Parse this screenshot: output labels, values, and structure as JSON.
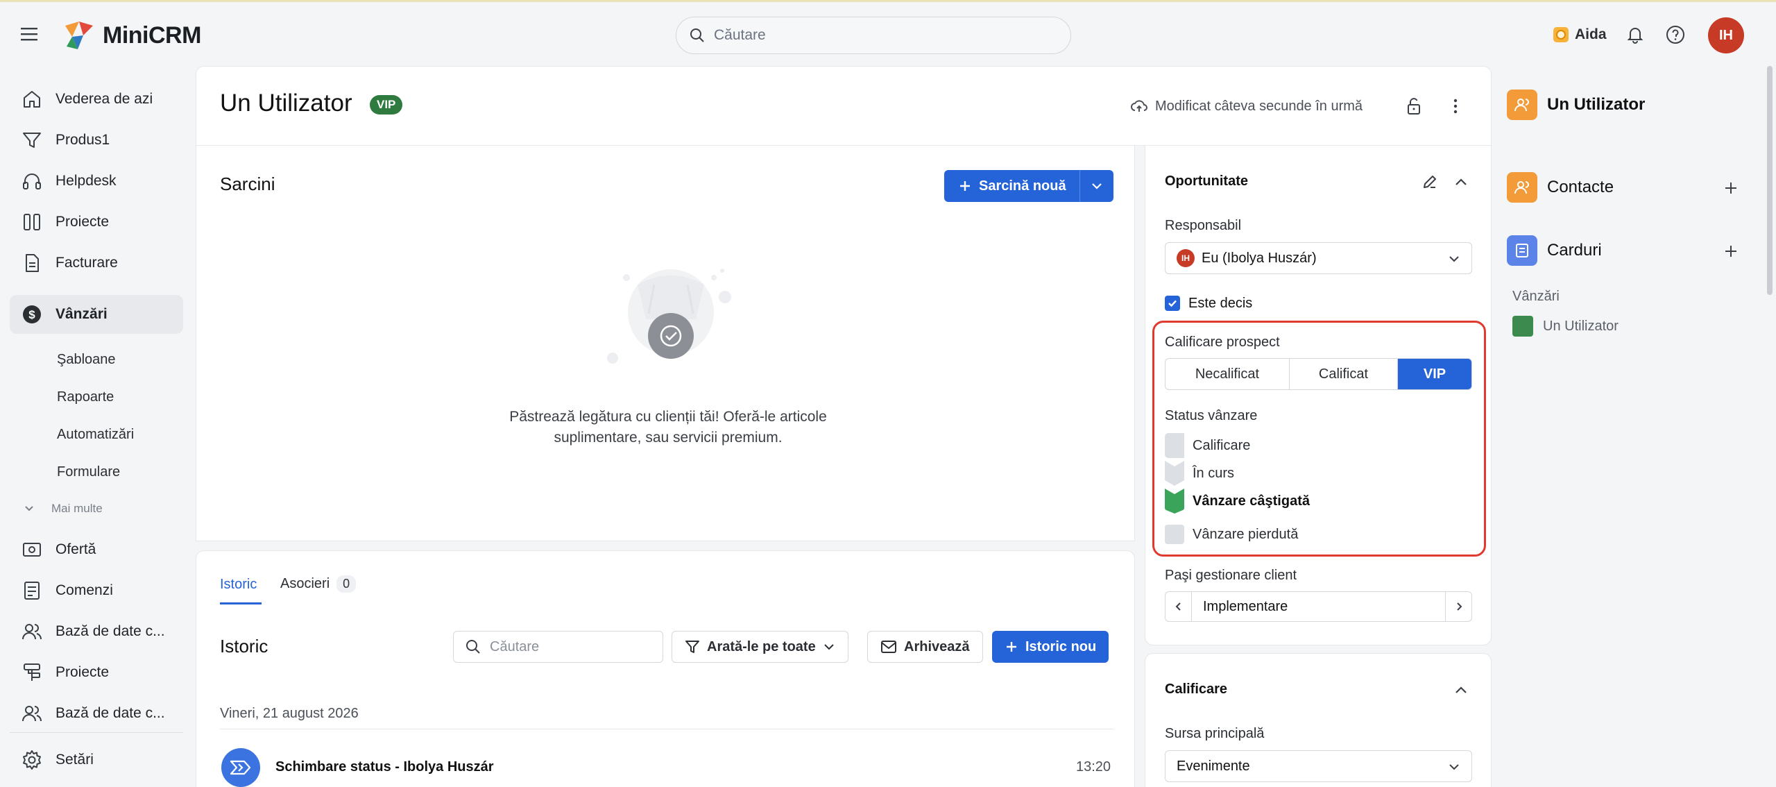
{
  "app": {
    "name": "MiniCRM",
    "search_placeholder": "Căutare",
    "assistant": "Aida",
    "user_initials": "IH"
  },
  "sidebar": {
    "items": [
      {
        "label": "Vederea de azi",
        "icon": "home-icon"
      },
      {
        "label": "Produs1",
        "icon": "filter-icon"
      },
      {
        "label": "Helpdesk",
        "icon": "headset-icon"
      },
      {
        "label": "Proiecte",
        "icon": "columns-icon"
      },
      {
        "label": "Facturare",
        "icon": "document-icon"
      },
      {
        "label": "Vânzări",
        "icon": "dollar-icon",
        "active": true
      }
    ],
    "subitems": [
      "Şabloane",
      "Rapoarte",
      "Automatizări",
      "Formulare"
    ],
    "more_label": "Mai multe",
    "items2": [
      {
        "label": "Ofertă",
        "icon": "offer-icon"
      },
      {
        "label": "Comenzi",
        "icon": "orders-icon"
      },
      {
        "label": "Bază de date c...",
        "icon": "users-icon"
      },
      {
        "label": "Proiecte",
        "icon": "hierarchy-icon"
      },
      {
        "label": "Bază de date c...",
        "icon": "users-icon"
      }
    ],
    "settings_label": "Setări"
  },
  "header": {
    "title": "Un Utilizator",
    "badge": "VIP",
    "modified": "Modificat câteva secunde în urmă"
  },
  "tasks": {
    "title": "Sarcini",
    "new_button": "Sarcină nouă",
    "empty_line1": "Păstrează legătura cu clienții tăi! Oferă-le articole",
    "empty_line2": "suplimentare, sau servicii premium."
  },
  "history": {
    "tab_history": "Istoric",
    "tab_assoc": "Asocieri",
    "assoc_count": "0",
    "title": "Istoric",
    "search_placeholder": "Căutare",
    "filter_label": "Arată-le pe toate",
    "archive_label": "Arhivează",
    "new_button": "Istoric nou",
    "date": "Vineri, 21 august 2026",
    "event_title": "Schimbare status - Ibolya Huszár",
    "event_time": "13:20"
  },
  "opportunity": {
    "title": "Oportunitate",
    "owner_label": "Responsabil",
    "owner_value": "Eu (Ibolya Huszár)",
    "owner_initials": "IH",
    "decided_label": "Este decis",
    "decided": true,
    "qual_label": "Calificare prospect",
    "qual_options": [
      "Necalificat",
      "Calificat",
      "VIP"
    ],
    "qual_selected": "VIP",
    "status_label": "Status vânzare",
    "statuses": [
      "Calificare",
      "În curs",
      "Vânzare câştigată",
      "Vânzare pierdută"
    ],
    "status_selected": "Vânzare câştigată",
    "steps_label": "Paşi gestionare client",
    "steps_value": "Implementare"
  },
  "qualification": {
    "title": "Calificare",
    "source_label": "Sursa principală",
    "source_value": "Evenimente"
  },
  "right_panel": {
    "contact_name": "Un Utilizator",
    "contacts_label": "Contacte",
    "cards_label": "Carduri",
    "sales_label": "Vânzări",
    "sales_item": "Un Utilizator"
  },
  "colors": {
    "primary": "#2563d9",
    "win": "#3aa55a",
    "vip_badge": "#2f7a3f",
    "highlight": "#e03a2e",
    "orange": "#f29b38",
    "avatar": "#c73a26"
  }
}
